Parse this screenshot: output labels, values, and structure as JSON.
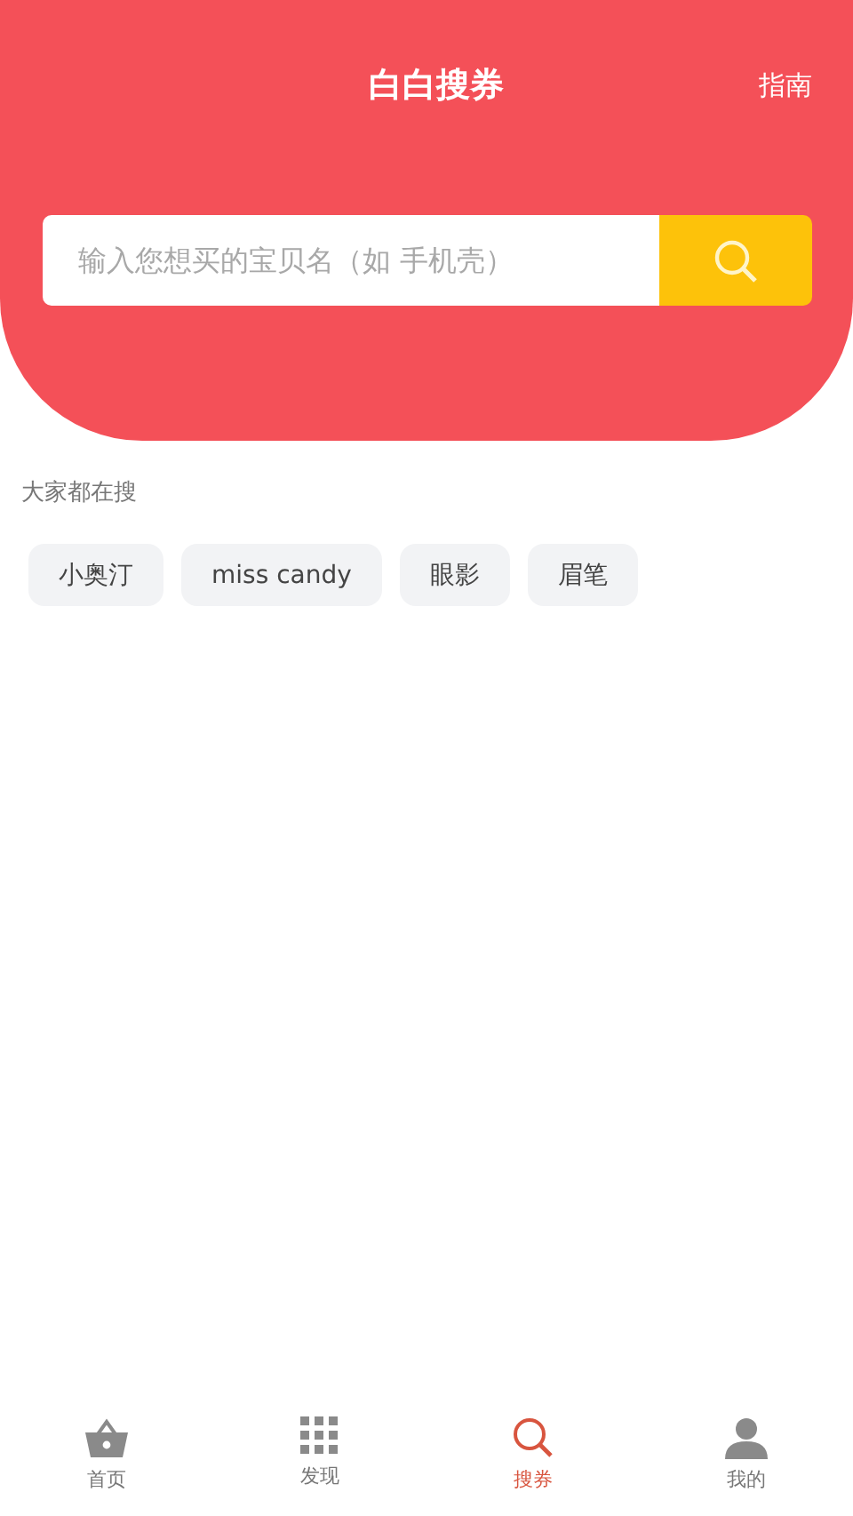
{
  "header": {
    "title": "白白搜券",
    "action": "指南"
  },
  "search": {
    "placeholder": "输入您想买的宝贝名（如 手机壳）"
  },
  "hot": {
    "title": "大家都在搜",
    "tags": [
      "小奥汀",
      "miss candy",
      "眼影",
      "眉笔"
    ]
  },
  "tabbar": [
    {
      "kind": "basket",
      "label": "首页",
      "selected": false
    },
    {
      "kind": "grid",
      "label": "发现",
      "selected": false
    },
    {
      "kind": "search",
      "label": "搜券",
      "selected": true
    },
    {
      "kind": "person",
      "label": "我的",
      "selected": false
    }
  ]
}
